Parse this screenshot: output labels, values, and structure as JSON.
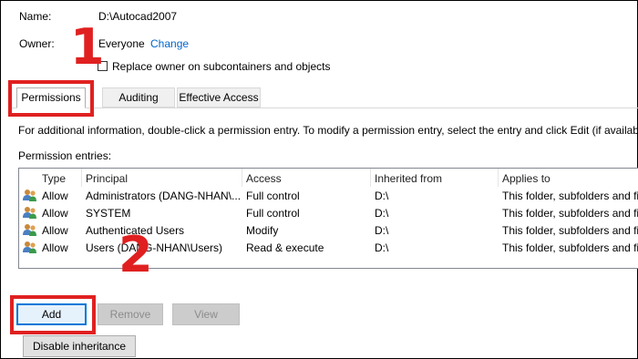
{
  "name_label": "Name:",
  "name_value": "D:\\Autocad2007",
  "owner_label": "Owner:",
  "owner_value": "Everyone",
  "owner_change": "Change",
  "replace_owner_label": "Replace owner on subcontainers and objects",
  "tabs": [
    "Permissions",
    "Auditing",
    "Effective Access"
  ],
  "info_text": "For additional information, double-click a permission entry. To modify a permission entry, select the entry and click Edit (if available).",
  "entries_label": "Permission entries:",
  "columns": [
    "Type",
    "Principal",
    "Access",
    "Inherited from",
    "Applies to"
  ],
  "rows": [
    {
      "type": "Allow",
      "principal": "Administrators (DANG-NHAN\\...",
      "access": "Full control",
      "inherited": "D:\\",
      "applies": "This folder, subfolders and fi"
    },
    {
      "type": "Allow",
      "principal": "SYSTEM",
      "access": "Full control",
      "inherited": "D:\\",
      "applies": "This folder, subfolders and fi"
    },
    {
      "type": "Allow",
      "principal": "Authenticated Users",
      "access": "Modify",
      "inherited": "D:\\",
      "applies": "This folder, subfolders and fi"
    },
    {
      "type": "Allow",
      "principal": "Users (DANG-NHAN\\Users)",
      "access": "Read & execute",
      "inherited": "D:\\",
      "applies": "This folder, subfolders and fi"
    }
  ],
  "buttons": {
    "add": "Add",
    "remove": "Remove",
    "view": "View",
    "disable_inheritance": "Disable inheritance"
  },
  "annotations": {
    "step1": "1",
    "step2": "2",
    "color": "#e02020"
  },
  "icons": {
    "user_group": "users-icon"
  }
}
